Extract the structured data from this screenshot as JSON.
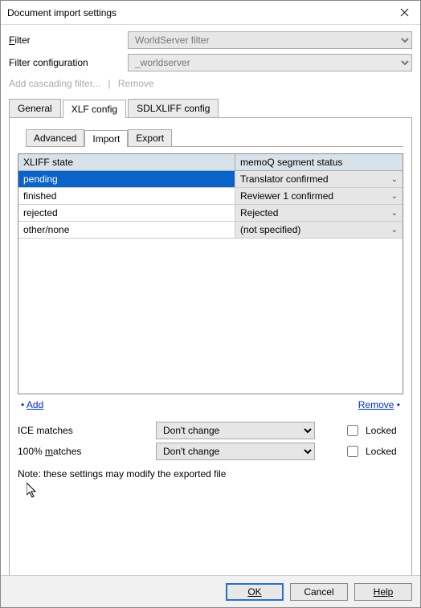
{
  "window": {
    "title": "Document import settings"
  },
  "filter": {
    "label": "Filter",
    "value": "WorldServer filter"
  },
  "filterConfig": {
    "label": "Filter configuration",
    "value": "_worldserver"
  },
  "actions": {
    "addCascading": "Add cascading filter...",
    "remove": "Remove"
  },
  "tabs": {
    "general": "General",
    "xlf": "XLF config",
    "sdlxliff": "SDLXLIFF config"
  },
  "subtabs": {
    "advanced": "Advanced",
    "import": "Import",
    "export": "Export"
  },
  "grid": {
    "headers": {
      "xliff": "XLIFF state",
      "segment": "memoQ segment status"
    },
    "rows": [
      {
        "xliff": "pending",
        "segment": "Translator confirmed"
      },
      {
        "xliff": "finished",
        "segment": "Reviewer 1 confirmed"
      },
      {
        "xliff": "rejected",
        "segment": "Rejected"
      },
      {
        "xliff": "other/none",
        "segment": "(not specified)"
      }
    ]
  },
  "gridActions": {
    "add": "Add",
    "remove": "Remove"
  },
  "iceMatches": {
    "label": "ICE matches",
    "value": "Don't change",
    "locked": "Locked"
  },
  "fullMatches": {
    "label": "100% matches",
    "value": "Don't change",
    "locked": "Locked"
  },
  "note": "Note: these settings may modify the exported file",
  "buttons": {
    "ok": "OK",
    "cancel": "Cancel",
    "help": "Help"
  },
  "bullets": {
    "dot": "•"
  }
}
